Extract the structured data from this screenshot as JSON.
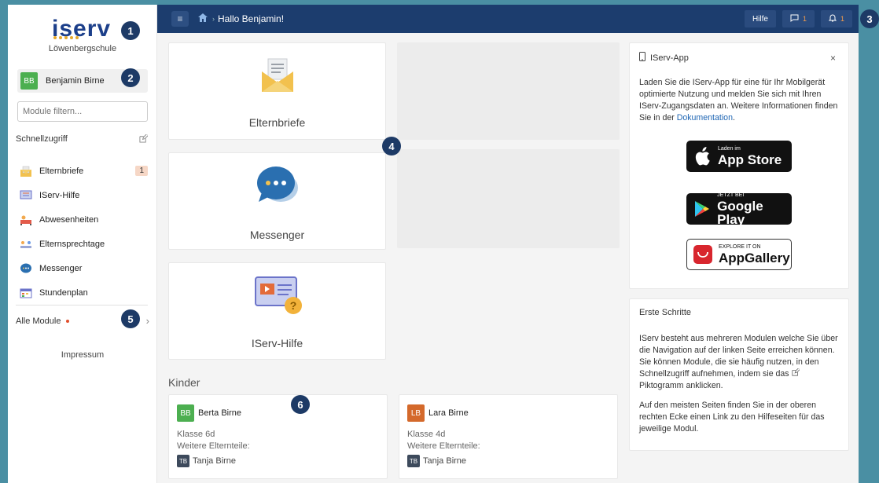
{
  "sidebar": {
    "logo": "iserv",
    "school": "Löwenbergschule",
    "user": {
      "initials": "BB",
      "name": "Benjamin Birne"
    },
    "filter_placeholder": "Module filtern...",
    "quick_access": "Schnellzugriff",
    "items": [
      {
        "label": "Elternbriefe",
        "icon": "letter-icon",
        "count": "1"
      },
      {
        "label": "IServ-Hilfe",
        "icon": "help-icon",
        "count": ""
      },
      {
        "label": "Abwesenheiten",
        "icon": "absence-icon",
        "count": ""
      },
      {
        "label": "Elternsprechtage",
        "icon": "meeting-icon",
        "count": ""
      },
      {
        "label": "Messenger",
        "icon": "messenger-icon",
        "count": ""
      },
      {
        "label": "Stundenplan",
        "icon": "timetable-icon",
        "count": ""
      }
    ],
    "all_modules": "Alle Module",
    "impressum": "Impressum"
  },
  "topbar": {
    "greeting": "Hallo Benjamin!",
    "help": "Hilfe",
    "messages_count": "1",
    "notifications_count": "1"
  },
  "tiles": [
    {
      "label": "Elternbriefe"
    },
    {
      "label": "Messenger"
    },
    {
      "label": "IServ-Hilfe"
    }
  ],
  "children": {
    "heading": "Kinder",
    "items": [
      {
        "initials": "BB",
        "name": "Berta Birne",
        "class": "Klasse 6d",
        "parents_label": "Weitere Elternteile:",
        "parent_initials": "TB",
        "parent_name": "Tanja Birne"
      },
      {
        "initials": "LB",
        "name": "Lara Birne",
        "class": "Klasse 4d",
        "parents_label": "Weitere Elternteile:",
        "parent_initials": "TB",
        "parent_name": "Tanja Birne"
      }
    ]
  },
  "app_panel": {
    "title": "IServ-App",
    "close": "×",
    "text": "Laden Sie die IServ-App für eine für Ihr Mobilgerät optimierte Nutzung und melden Sie sich mit Ihren IServ-Zugangsdaten an. Weitere Informationen finden Sie in der ",
    "link": "Dokumentation",
    "text_end": ".",
    "stores": [
      {
        "small": "Laden im",
        "big": "App Store"
      },
      {
        "small": "JETZT BEI",
        "big": "Google Play"
      },
      {
        "small": "EXPLORE IT ON",
        "big": "AppGallery"
      }
    ]
  },
  "first_steps": {
    "title": "Erste Schritte",
    "p1": "IServ besteht aus mehreren Modulen welche Sie über die Navigation auf der linken Seite erreichen können. Sie können Module, die sie häufig nutzen, in den Schnellzugriff aufnehmen, indem sie das",
    "p1_end": "Piktogramm anklicken.",
    "p2": "Auf den meisten Seiten finden Sie in der oberen rechten Ecke einen Link zu den Hilfeseiten für das jeweilige Modul."
  },
  "markers": [
    "1",
    "2",
    "3",
    "4",
    "5",
    "6"
  ],
  "colors": {
    "topbar": "#1c3d6e",
    "background": "#4a8fa3",
    "marker": "#1d3a66",
    "logo": "#1c3f8a"
  }
}
